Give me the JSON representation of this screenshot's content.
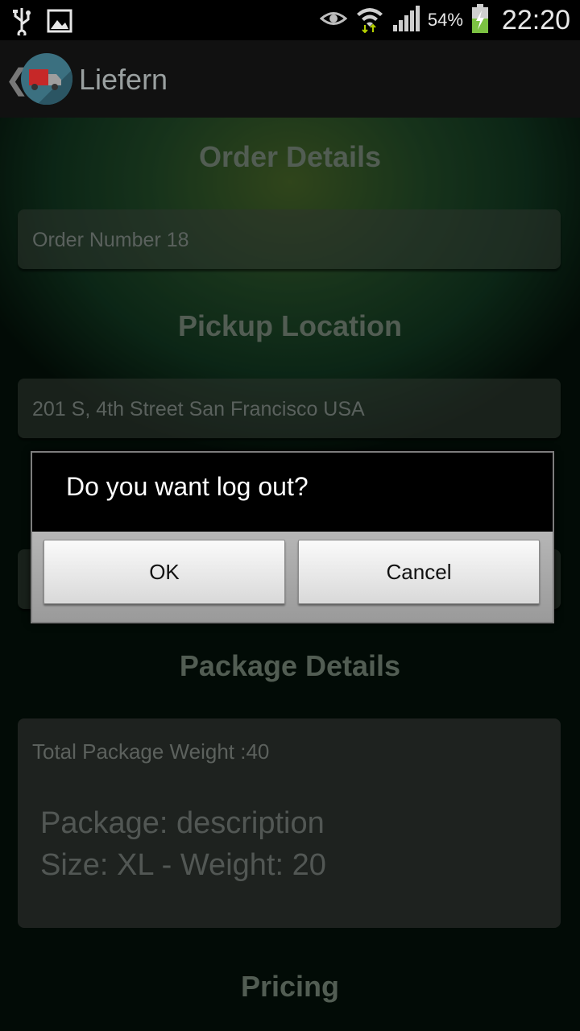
{
  "status_bar": {
    "icons": [
      "usb-icon",
      "image-icon",
      "eye-icon",
      "wifi-icon",
      "signal-icon",
      "battery-charging-icon"
    ],
    "battery_percent": "54%",
    "time": "22:20"
  },
  "action_bar": {
    "title": "Liefern"
  },
  "sections": {
    "order_details": "Order Details",
    "order_number": "Order Number 18",
    "pickup_location": "Pickup Location",
    "pickup_address": "201 S, 4th Street San Francisco USA",
    "package_details": "Package Details",
    "total_weight": "Total Package Weight :40",
    "package_line1": "Package: description",
    "package_line2": "Size: XL - Weight: 20",
    "pricing": "Pricing"
  },
  "dialog": {
    "message": "Do you want log out?",
    "ok_label": "OK",
    "cancel_label": "Cancel"
  },
  "colors": {
    "background_green": "#244f2a",
    "dialog_black": "#000000",
    "button_grey": "#e6e6e6"
  }
}
